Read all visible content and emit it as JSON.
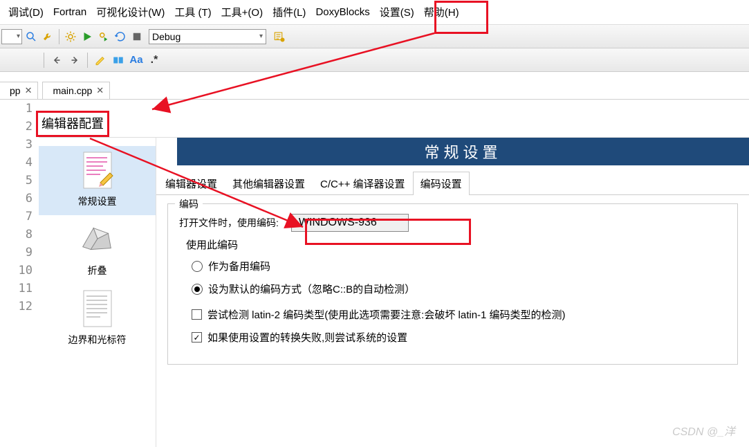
{
  "menubar": {
    "debug": "调试(D)",
    "fortran": "Fortran",
    "visualDesign": "可视化设计(W)",
    "tools": "工具 (T)",
    "toolsPlus": "工具+(O)",
    "plugins": "插件(L)",
    "doxyblocks": "DoxyBlocks",
    "settings": "设置(S)",
    "help": "帮助(H)"
  },
  "toolbar": {
    "config_dropdown": "Debug"
  },
  "tabs": {
    "pp_suffix": "pp",
    "main_cpp": "main.cpp"
  },
  "gutter_lines": [
    "1",
    "2",
    "3",
    "4",
    "5",
    "6",
    "7",
    "8",
    "9",
    "10",
    "11",
    "12"
  ],
  "config_dialog": {
    "title": "编辑器配置",
    "header": "常规设置",
    "side": {
      "general": "常规设置",
      "folding": "折叠",
      "margins": "边界和光标符"
    },
    "subtabs": {
      "editor": "编辑器设置",
      "other": "其他编辑器设置",
      "cpp": "C/C++ 编译器设置",
      "encoding": "编码设置"
    },
    "encoding_panel": {
      "legend": "编码",
      "open_label": "打开文件时，使用编码:",
      "encoding_value": "WINDOWS-936",
      "use_label": "使用此编码",
      "radio_fallback": "作为备用编码",
      "radio_default": "设为默认的编码方式（忽略C::B的自动检测）",
      "check_latin2": "尝试检测 latin-2 编码类型(使用此选项需要注意:会破坏 latin-1 编码类型的检测)",
      "check_system": "如果使用设置的转换失败,则尝试系统的设置"
    }
  },
  "watermark": "CSDN @_洋"
}
